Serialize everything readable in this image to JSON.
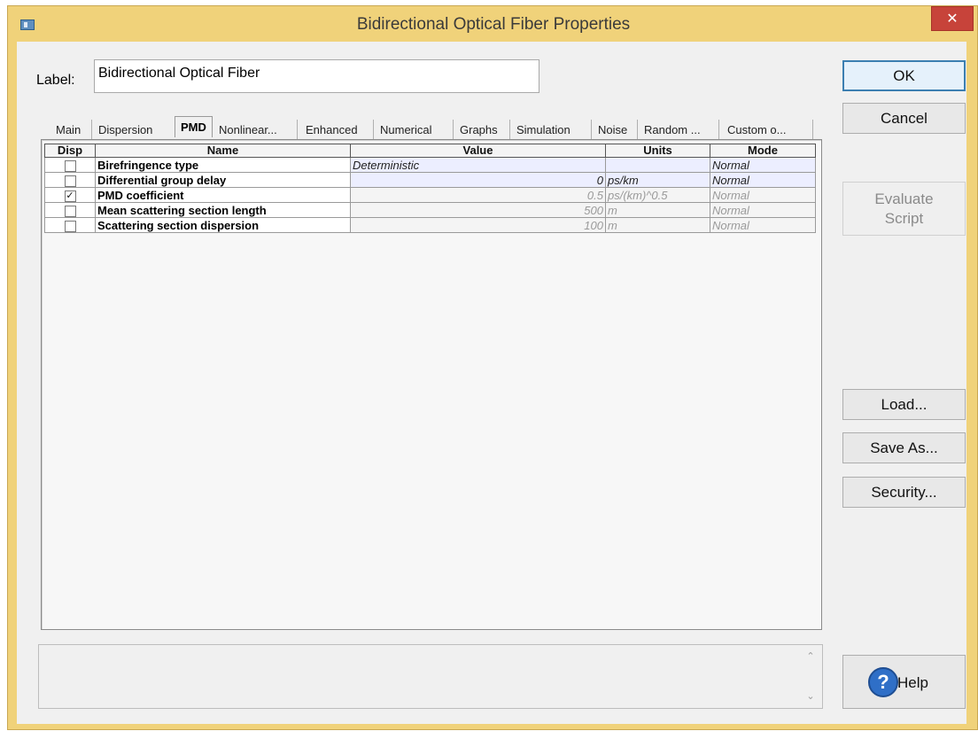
{
  "window": {
    "title": "Bidirectional Optical Fiber Properties",
    "close_glyph": "✕"
  },
  "label": {
    "caption": "Label:",
    "value": "Bidirectional Optical Fiber"
  },
  "tabs": [
    {
      "label": "Main",
      "active": false
    },
    {
      "label": "Dispersion",
      "active": false
    },
    {
      "label": "PMD",
      "active": true
    },
    {
      "label": "Nonlinear...",
      "active": false
    },
    {
      "label": "Enhanced",
      "active": false
    },
    {
      "label": "Numerical",
      "active": false
    },
    {
      "label": "Graphs",
      "active": false
    },
    {
      "label": "Simulation",
      "active": false
    },
    {
      "label": "Noise",
      "active": false
    },
    {
      "label": "Random ...",
      "active": false
    },
    {
      "label": "Custom o...",
      "active": false
    }
  ],
  "table": {
    "headers": {
      "disp": "Disp",
      "name": "Name",
      "value": "Value",
      "units": "Units",
      "mode": "Mode"
    },
    "rows": [
      {
        "disp": false,
        "name": "Birefringence type",
        "value": "Deterministic",
        "units": "",
        "mode": "Normal",
        "state": "editable"
      },
      {
        "disp": false,
        "name": "Differential group delay",
        "value": "0",
        "units": "ps/km",
        "mode": "Normal",
        "state": "editable"
      },
      {
        "disp": true,
        "name": "PMD coefficient",
        "value": "0.5",
        "units": "ps/(km)^0.5",
        "mode": "Normal",
        "state": "readonly"
      },
      {
        "disp": false,
        "name": "Mean scattering section length",
        "value": "500",
        "units": "m",
        "mode": "Normal",
        "state": "readonly"
      },
      {
        "disp": false,
        "name": "Scattering section dispersion",
        "value": "100",
        "units": "m",
        "mode": "Normal",
        "state": "readonly"
      }
    ]
  },
  "buttons": {
    "ok": "OK",
    "cancel": "Cancel",
    "evaluate_line1": "Evaluate",
    "evaluate_line2": "Script",
    "load": "Load...",
    "save_as": "Save As...",
    "security": "Security...",
    "help": "Help",
    "help_glyph": "?"
  },
  "description_scroll": {
    "up": "⌃",
    "down": "⌄"
  },
  "check_glyph": "✓"
}
